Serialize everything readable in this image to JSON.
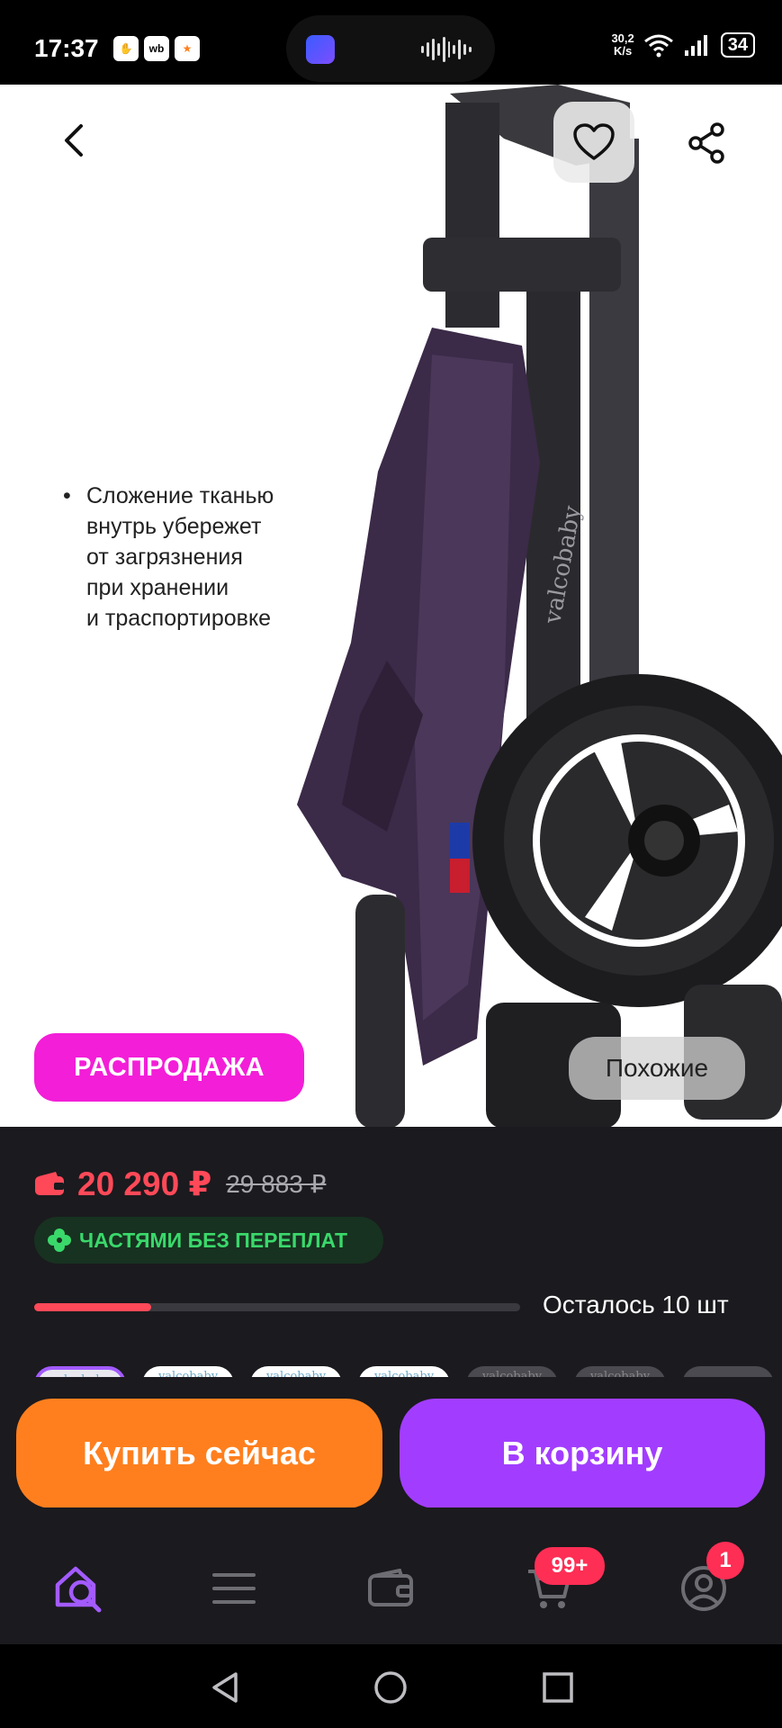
{
  "status_bar": {
    "time": "17:37",
    "left_icons": [
      "hand-icon",
      "wb",
      "star-app-icon"
    ],
    "left_icon_text": [
      "✋",
      "wb",
      "★"
    ],
    "network_speed": "30,2",
    "network_unit": "K/s",
    "battery": "34"
  },
  "hero": {
    "caption": "Сложение тканью\nвнутрь убережет\nот загрязнения\nпри хранении\nи траспортировке",
    "caption_lines": [
      "Сложение тканью",
      "внутрь убережет",
      "от загрязнения",
      "при хранении",
      "и траспортировке"
    ],
    "brand_on_frame": "valcobaby",
    "sale_badge": "РАСПРОДАЖА",
    "similar_button": "Похожие"
  },
  "price": {
    "current": "20 290 ₽",
    "old": "29 883 ₽",
    "installment": "ЧАСТЯМИ БЕЗ ПЕРЕПЛАТ",
    "stock_label": "Осталось 10 шт",
    "stock_fraction": 0.24
  },
  "thumbnails": [
    {
      "label": "valcobaby",
      "active": true
    },
    {
      "label": "valcobaby",
      "active": false
    },
    {
      "label": "valcobaby",
      "active": false
    },
    {
      "label": "valcobaby",
      "active": false
    },
    {
      "label": "valcobaby",
      "active": false
    },
    {
      "label": "valcobaby",
      "active": false
    },
    {
      "label": "",
      "active": false
    }
  ],
  "actions": {
    "buy_now": "Купить сейчас",
    "add_to_cart": "В корзину"
  },
  "bottom_nav": {
    "cart_badge": "99+",
    "profile_badge": "1"
  },
  "colors": {
    "accent_purple": "#a23dff",
    "buy_orange": "#ff7f1e",
    "price_red": "#ff4958",
    "sale_pink": "#f31ed8",
    "installment_green": "#3ad86b"
  }
}
